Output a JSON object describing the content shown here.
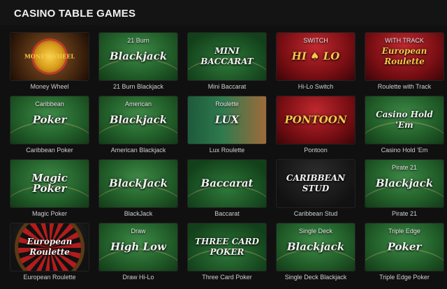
{
  "header": {
    "title": "CASINO TABLE GAMES"
  },
  "games": [
    {
      "label": "Money Wheel",
      "art": "MONEY WHEEL",
      "theme": "wheel-money"
    },
    {
      "label": "21 Burn Blackjack",
      "art": "Blackjack",
      "sub": "21 Burn",
      "theme": "felt"
    },
    {
      "label": "Mini Baccarat",
      "art": "MINI BACCARAT",
      "theme": "baccarat"
    },
    {
      "label": "Hi-Lo Switch",
      "art": "HI ♠ LO",
      "sub": "SWITCH",
      "theme": "red"
    },
    {
      "label": "Roulette with Track",
      "art": "European Roulette",
      "sub": "WITH TRACK",
      "theme": "roulette-track"
    },
    {
      "label": "Caribbean Poker",
      "art": "Poker",
      "sub": "Caribbean",
      "theme": "felt"
    },
    {
      "label": "American Blackjack",
      "art": "Blackjack",
      "sub": "American",
      "theme": "felt"
    },
    {
      "label": "Lux Roulette",
      "art": "LUX",
      "sub": "Roulette",
      "theme": "lux"
    },
    {
      "label": "Pontoon",
      "art": "PONTOON",
      "theme": "red"
    },
    {
      "label": "Casino Hold 'Em",
      "art": "Casino Hold 'Em",
      "theme": "felt"
    },
    {
      "label": "Magic Poker",
      "art": "Magic Poker",
      "theme": "felt"
    },
    {
      "label": "BlackJack",
      "art": "BlackJack",
      "theme": "felt"
    },
    {
      "label": "Baccarat",
      "art": "Baccarat",
      "theme": "baccarat"
    },
    {
      "label": "Caribbean Stud",
      "art": "CARIBBEAN STUD",
      "theme": "dark"
    },
    {
      "label": "Pirate 21",
      "art": "Blackjack",
      "sub": "Pirate 21",
      "theme": "felt"
    },
    {
      "label": "European Roulette",
      "art": "European Roulette",
      "theme": "wheel"
    },
    {
      "label": "Draw Hi-Lo",
      "art": "High Low",
      "sub": "Draw",
      "theme": "felt"
    },
    {
      "label": "Three Card Poker",
      "art": "THREE CARD POKER",
      "theme": "dark-felt"
    },
    {
      "label": "Single Deck Blackjack",
      "art": "Blackjack",
      "sub": "Single Deck",
      "theme": "felt"
    },
    {
      "label": "Triple Edge Poker",
      "art": "Poker",
      "sub": "Triple Edge",
      "theme": "felt"
    }
  ]
}
